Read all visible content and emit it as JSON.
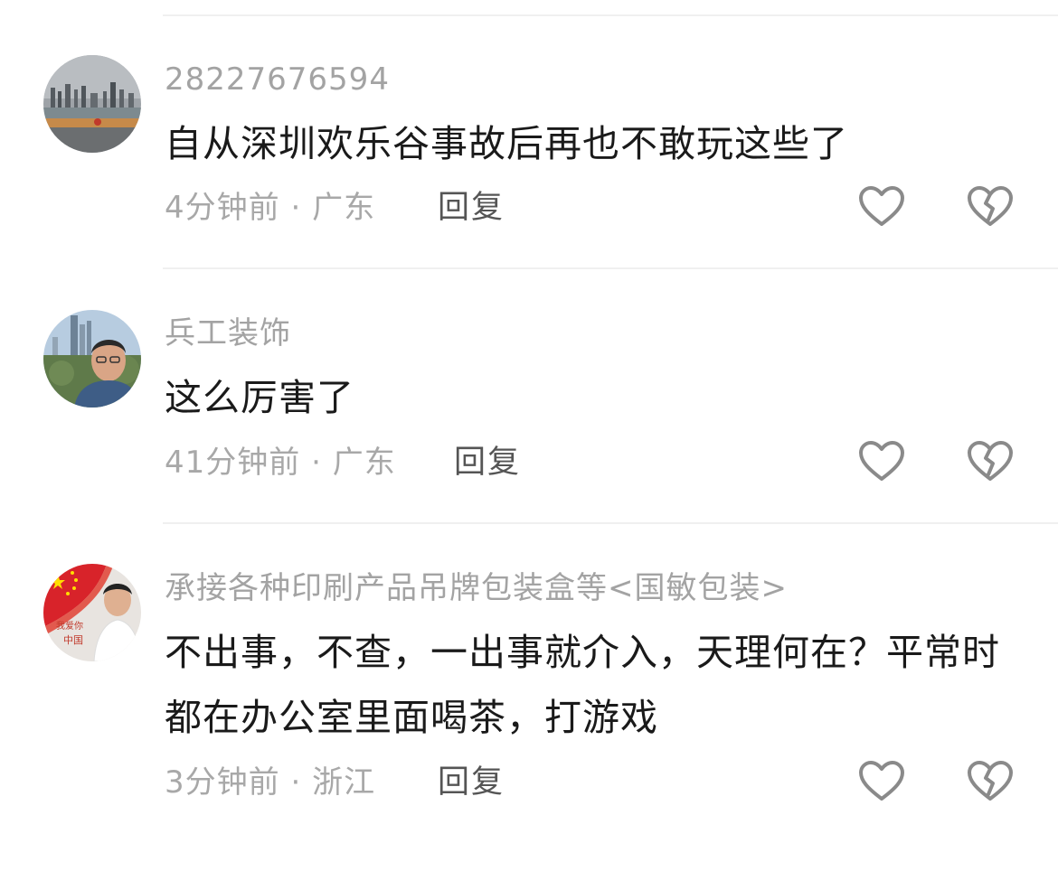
{
  "comments": [
    {
      "username": "28227676594",
      "content": "自从深圳欢乐谷事故后再也不敢玩这些了",
      "time": "4分钟前",
      "separator": "·",
      "location": "广东",
      "reply_label": "回复",
      "avatar_icon": "city-skyline-avatar"
    },
    {
      "username": "兵工装饰",
      "content": "这么厉害了",
      "time": "41分钟前",
      "separator": "·",
      "location": "广东",
      "reply_label": "回复",
      "avatar_icon": "man-portrait-avatar"
    },
    {
      "username": "承接各种印刷产品吊牌包装盒等<国敏包装>",
      "content": "不出事，不查，一出事就介入，天理何在？平常时都在办公室里面喝茶，打游戏",
      "time": "3分钟前",
      "separator": "·",
      "location": "浙江",
      "reply_label": "回复",
      "avatar_icon": "flag-portrait-avatar"
    }
  ],
  "icons": {
    "like": "heart-outline-icon",
    "dislike": "broken-heart-icon"
  },
  "colors": {
    "username": "#a3a3a3",
    "content": "#1a1a1a",
    "meta": "#a8a8a8",
    "reply": "#555555",
    "icon": "#8a8a8a"
  }
}
